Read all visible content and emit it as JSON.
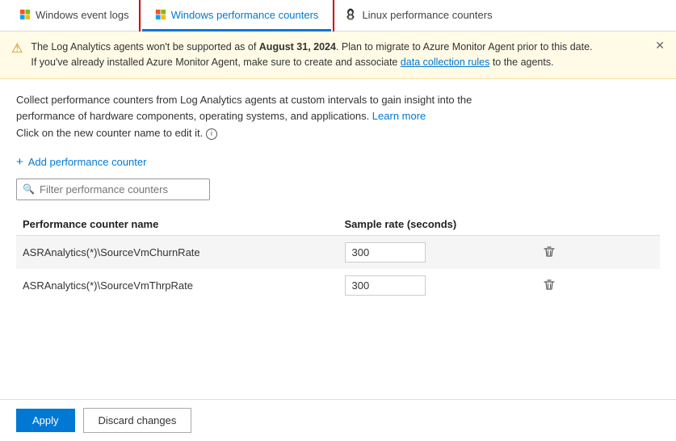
{
  "tabs": [
    {
      "id": "windows-event-logs",
      "label": "Windows event logs",
      "icon": "windows-icon",
      "active": false
    },
    {
      "id": "windows-perf-counters",
      "label": "Windows performance counters",
      "icon": "windows-icon",
      "active": true
    },
    {
      "id": "linux-perf-counters",
      "label": "Linux performance counters",
      "icon": "linux-icon",
      "active": false
    }
  ],
  "banner": {
    "text_before": "The Log Analytics agents won't be supported as of ",
    "bold_date": "August 31, 2024",
    "text_after": ". Plan to migrate to Azure Monitor Agent prior to this date.",
    "text_line2_before": "If you've already installed Azure Monitor Agent, make sure to create and associate ",
    "link_text": "data collection rules",
    "text_line2_after": " to the agents."
  },
  "description": {
    "line1": "Collect performance counters from Log Analytics agents at custom intervals to gain insight into the",
    "line2": "performance of hardware components, operating systems, and applications.",
    "learn_more": "Learn more",
    "line3": "Click on the new counter name to edit it.",
    "info_icon": "ⓘ"
  },
  "add_counter": {
    "label": "Add performance counter"
  },
  "filter": {
    "placeholder": "Filter performance counters"
  },
  "table": {
    "columns": [
      {
        "id": "name",
        "label": "Performance counter name"
      },
      {
        "id": "sample_rate",
        "label": "Sample rate (seconds)"
      }
    ],
    "rows": [
      {
        "id": "row-1",
        "name": "ASRAnalytics(*)\\SourceVmChurnRate",
        "sample_rate": "300"
      },
      {
        "id": "row-2",
        "name": "ASRAnalytics(*)\\SourceVmThrpRate",
        "sample_rate": "300"
      }
    ]
  },
  "footer": {
    "apply_label": "Apply",
    "discard_label": "Discard changes"
  }
}
